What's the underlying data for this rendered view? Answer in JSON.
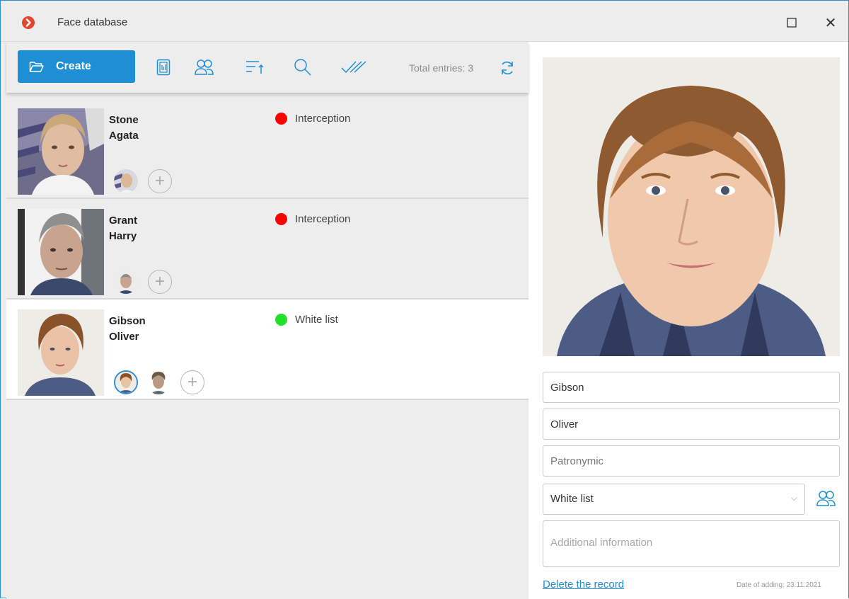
{
  "window": {
    "title": "Face database",
    "maximize_icon": "maximize-icon",
    "close_icon": "close-icon",
    "close_glyph": "✕"
  },
  "toolbar": {
    "create_label": "Create",
    "total_label": "Total entries: 3",
    "icons": [
      "folder-open-icon",
      "report-icon",
      "groups-icon",
      "sort-icon",
      "search-icon",
      "check-all-icon",
      "refresh-icon"
    ]
  },
  "records": [
    {
      "surname": "Stone",
      "name": "Agata",
      "status": "Interception",
      "status_color": "#ff0000",
      "selected": false
    },
    {
      "surname": "Grant",
      "name": "Harry",
      "status": "Interception",
      "status_color": "#ff0000",
      "selected": false
    },
    {
      "surname": "Gibson",
      "name": "Oliver",
      "status": "White list",
      "status_color": "#22e02a",
      "selected": true
    }
  ],
  "detail": {
    "surname_value": "Gibson",
    "name_value": "Oliver",
    "patronymic_placeholder": "Patronymic",
    "list_value": "White list",
    "additional_placeholder": "Additional information",
    "delete_label": "Delete the record",
    "date_label": "Date of adding: 23.11.2021"
  },
  "colors": {
    "accent": "#1e8fd4",
    "logo": "#e4462d",
    "interception": "#ff0000",
    "white_list": "#22e02a"
  }
}
